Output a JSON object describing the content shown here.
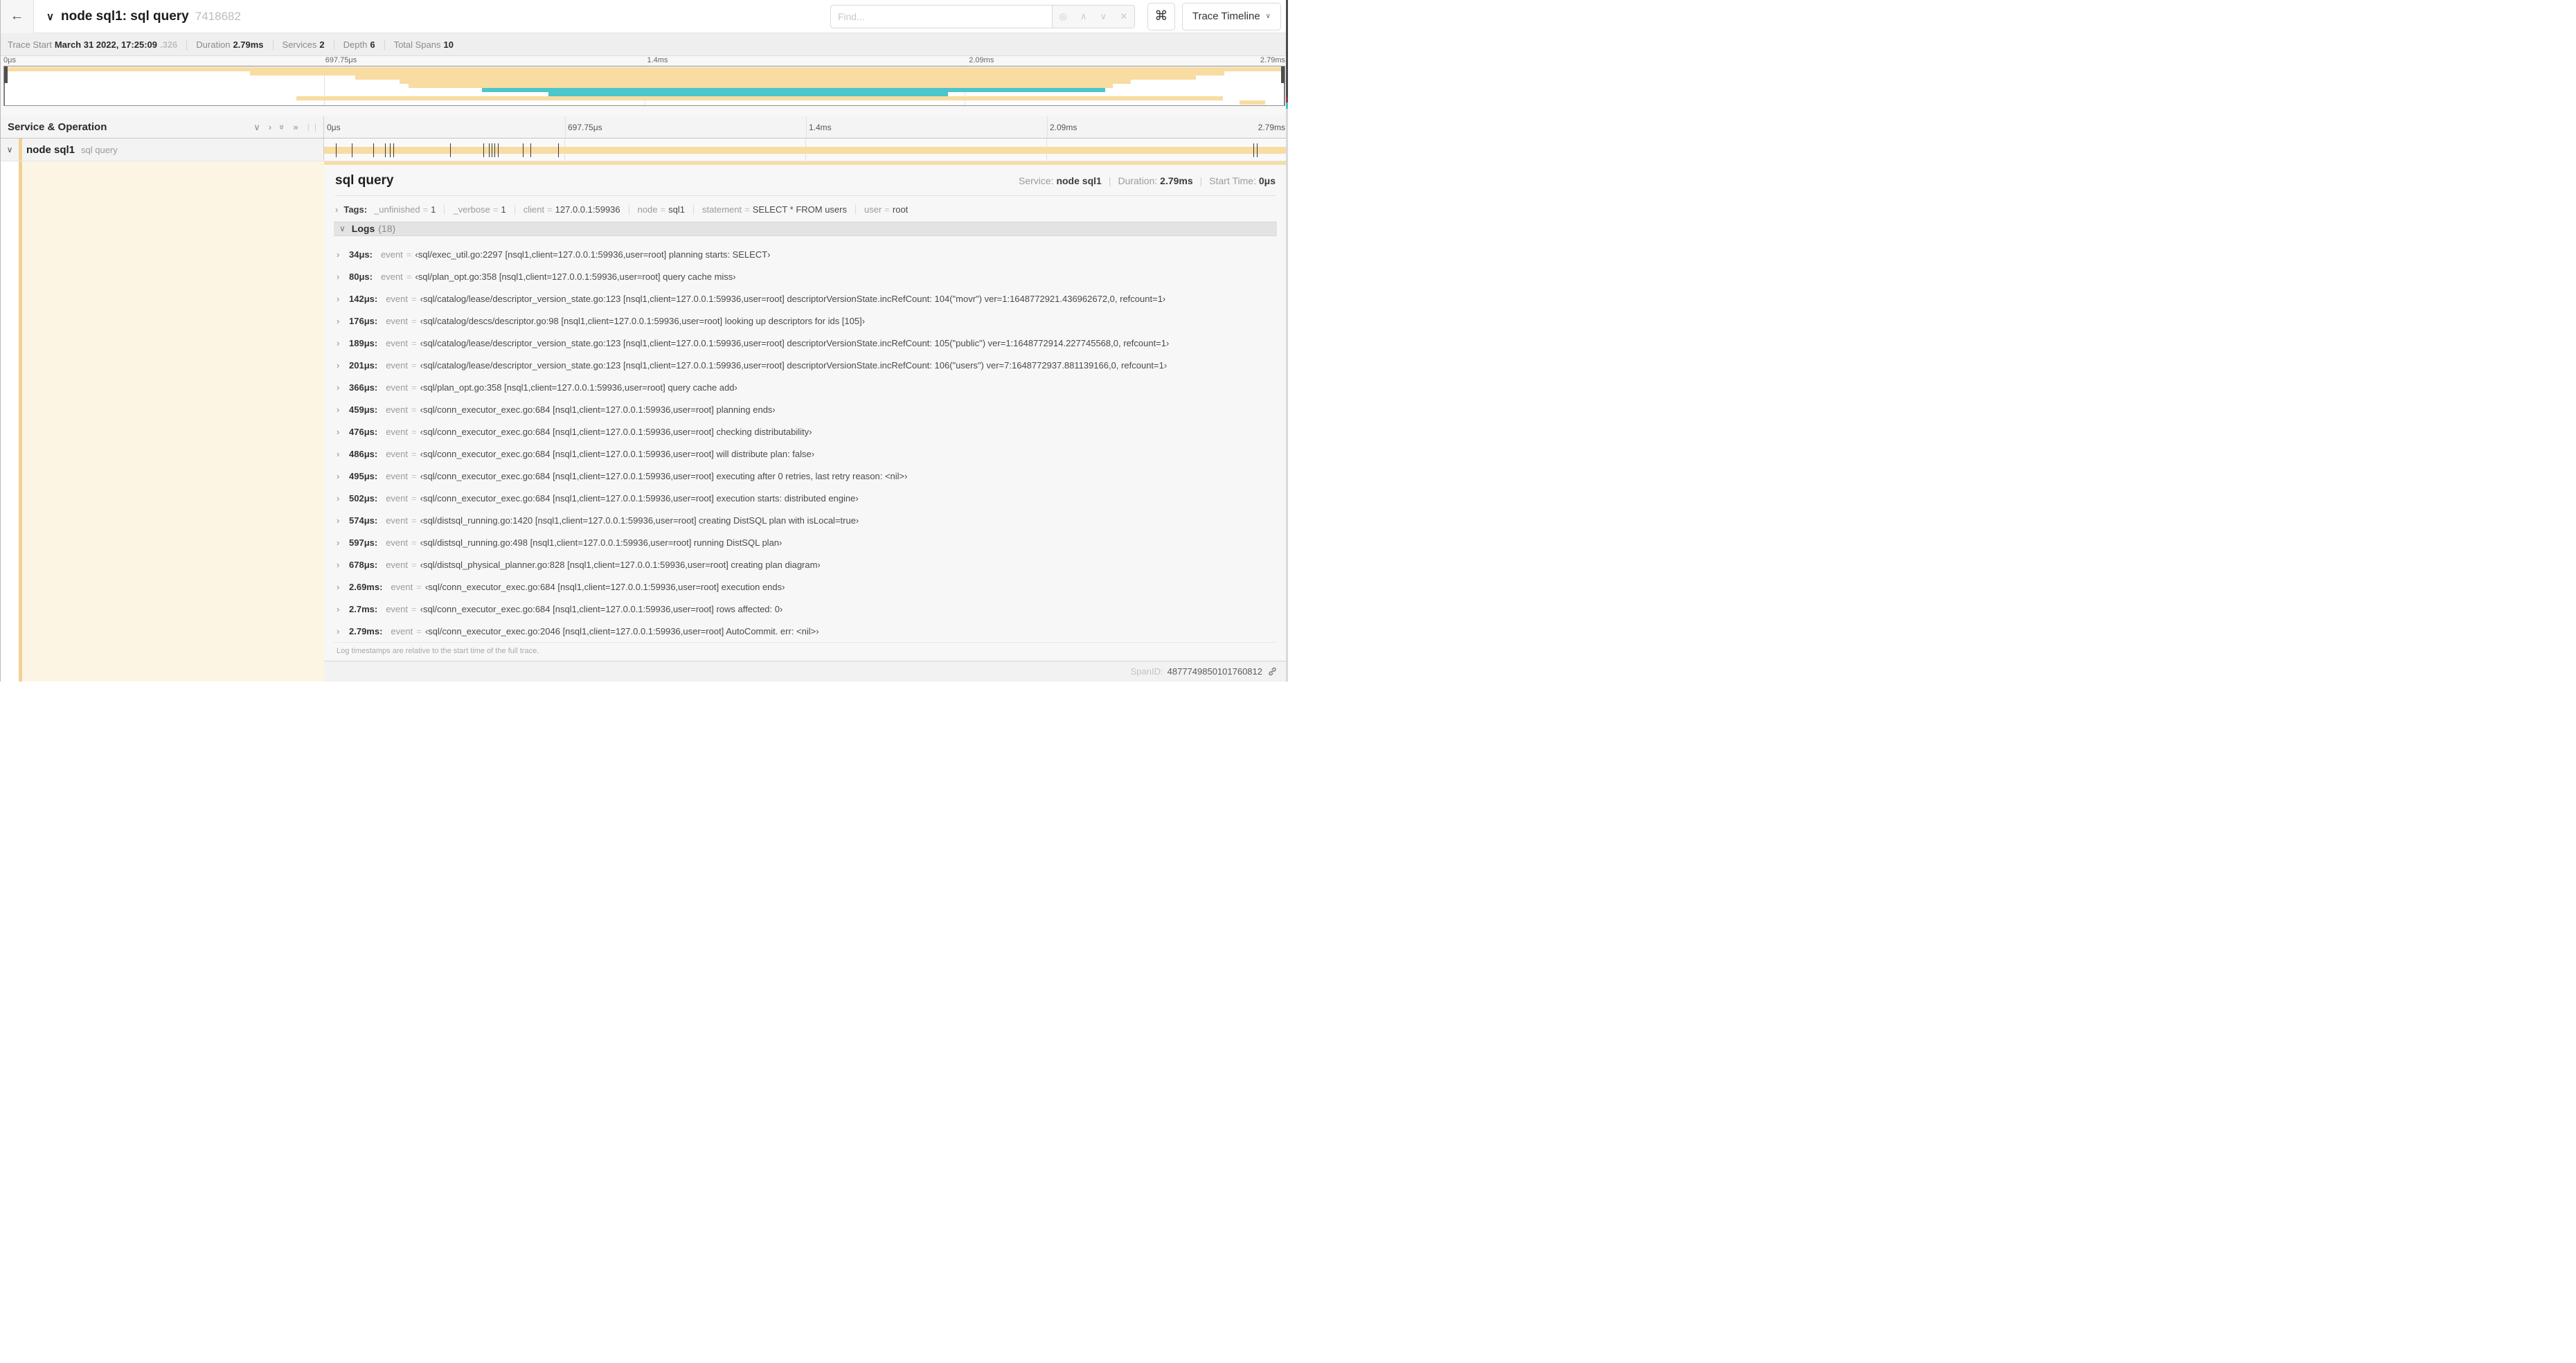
{
  "colors": {
    "tan": "#f8dca2",
    "teal": "#4bc6ca",
    "cream": "#fdf5e4",
    "stripe": "#f1d195"
  },
  "topbar": {
    "back": "←",
    "collapse_chevron": "∨",
    "title": "node sql1: sql query",
    "trace_id": "7418682",
    "find_placeholder": "Find...",
    "shortcut": "⌘",
    "view_select": "Trace Timeline"
  },
  "summary": {
    "items": [
      {
        "label": "Trace Start",
        "value": "March 31 2022, 17:25:09",
        "suffix": ".326"
      },
      {
        "label": "Duration",
        "value": "2.79ms"
      },
      {
        "label": "Services",
        "value": "2"
      },
      {
        "label": "Depth",
        "value": "6"
      },
      {
        "label": "Total Spans",
        "value": "10"
      }
    ]
  },
  "timeline": {
    "ticks": [
      "0μs",
      "697.75μs",
      "1.4ms",
      "2.09ms",
      "2.79ms"
    ],
    "tick_positions": [
      0,
      25,
      50,
      75,
      100
    ],
    "gridlines": [
      25,
      50,
      75
    ],
    "minimap_spans": [
      {
        "color": "tan",
        "start": 0.0,
        "end": 1.0
      },
      {
        "color": "tan",
        "start": 0.192,
        "end": 0.953
      },
      {
        "color": "tan",
        "start": 0.274,
        "end": 0.931
      },
      {
        "color": "tan",
        "start": 0.309,
        "end": 0.88
      },
      {
        "color": "tan",
        "start": 0.316,
        "end": 0.866
      },
      {
        "color": "teal",
        "start": 0.373,
        "end": 0.86
      },
      {
        "color": "teal",
        "start": 0.425,
        "end": 0.737
      },
      {
        "color": "tan",
        "start": 0.228,
        "end": 0.952
      },
      {
        "color": "tan",
        "start": 0.965,
        "end": 0.985
      }
    ],
    "log_marks": [
      0.012,
      0.029,
      0.051,
      0.063,
      0.068,
      0.072,
      0.131,
      0.165,
      0.171,
      0.174,
      0.177,
      0.18,
      0.206,
      0.214,
      0.243,
      0.964,
      0.968,
      0.999
    ]
  },
  "span_list": {
    "header": "Service & Operation",
    "row": {
      "chevron": "∨",
      "service": "node sql1",
      "operation": "sql query"
    }
  },
  "detail": {
    "title": "sql query",
    "service_label": "Service:",
    "service": "node sql1",
    "duration_label": "Duration:",
    "duration": "2.79ms",
    "start_label": "Start Time:",
    "start": "0μs",
    "tags_label": "Tags:",
    "tags": [
      {
        "k": "_unfinished",
        "v": "1"
      },
      {
        "k": "_verbose",
        "v": "1"
      },
      {
        "k": "client",
        "v": "127.0.0.1:59936"
      },
      {
        "k": "node",
        "v": "sql1"
      },
      {
        "k": "statement",
        "v": "SELECT * FROM users"
      },
      {
        "k": "user",
        "v": "root"
      }
    ],
    "logs_label": "Logs",
    "logs_count": "(18)",
    "log_key": "event",
    "logs": [
      {
        "t": "34μs:",
        "v": "sql/exec_util.go:2297 [nsql1,client=127.0.0.1:59936,user=root] planning starts: SELECT"
      },
      {
        "t": "80μs:",
        "v": "sql/plan_opt.go:358 [nsql1,client=127.0.0.1:59936,user=root] query cache miss"
      },
      {
        "t": "142μs:",
        "v": "sql/catalog/lease/descriptor_version_state.go:123 [nsql1,client=127.0.0.1:59936,user=root] descriptorVersionState.incRefCount: 104(\"movr\") ver=1:1648772921.436962672,0, refcount=1"
      },
      {
        "t": "176μs:",
        "v": "sql/catalog/descs/descriptor.go:98 [nsql1,client=127.0.0.1:59936,user=root] looking up descriptors for ids [105]"
      },
      {
        "t": "189μs:",
        "v": "sql/catalog/lease/descriptor_version_state.go:123 [nsql1,client=127.0.0.1:59936,user=root] descriptorVersionState.incRefCount: 105(\"public\") ver=1:1648772914.227745568,0, refcount=1"
      },
      {
        "t": "201μs:",
        "v": "sql/catalog/lease/descriptor_version_state.go:123 [nsql1,client=127.0.0.1:59936,user=root] descriptorVersionState.incRefCount: 106(\"users\") ver=7:1648772937.881139166,0, refcount=1"
      },
      {
        "t": "366μs:",
        "v": "sql/plan_opt.go:358 [nsql1,client=127.0.0.1:59936,user=root] query cache add"
      },
      {
        "t": "459μs:",
        "v": "sql/conn_executor_exec.go:684 [nsql1,client=127.0.0.1:59936,user=root] planning ends"
      },
      {
        "t": "476μs:",
        "v": "sql/conn_executor_exec.go:684 [nsql1,client=127.0.0.1:59936,user=root] checking distributability"
      },
      {
        "t": "486μs:",
        "v": "sql/conn_executor_exec.go:684 [nsql1,client=127.0.0.1:59936,user=root] will distribute plan: false"
      },
      {
        "t": "495μs:",
        "v": "sql/conn_executor_exec.go:684 [nsql1,client=127.0.0.1:59936,user=root] executing after 0 retries, last retry reason: <nil>"
      },
      {
        "t": "502μs:",
        "v": "sql/conn_executor_exec.go:684 [nsql1,client=127.0.0.1:59936,user=root] execution starts: distributed engine"
      },
      {
        "t": "574μs:",
        "v": "sql/distsql_running.go:1420 [nsql1,client=127.0.0.1:59936,user=root] creating DistSQL plan with isLocal=true"
      },
      {
        "t": "597μs:",
        "v": "sql/distsql_running.go:498 [nsql1,client=127.0.0.1:59936,user=root] running DistSQL plan"
      },
      {
        "t": "678μs:",
        "v": "sql/distsql_physical_planner.go:828 [nsql1,client=127.0.0.1:59936,user=root] creating plan diagram"
      },
      {
        "t": "2.69ms:",
        "v": "sql/conn_executor_exec.go:684 [nsql1,client=127.0.0.1:59936,user=root] execution ends"
      },
      {
        "t": "2.7ms:",
        "v": "sql/conn_executor_exec.go:684 [nsql1,client=127.0.0.1:59936,user=root] rows affected: 0"
      },
      {
        "t": "2.79ms:",
        "v": "sql/conn_executor_exec.go:2046 [nsql1,client=127.0.0.1:59936,user=root] AutoCommit. err: <nil>"
      }
    ],
    "footer_note": "Log timestamps are relative to the start time of the full trace.",
    "spanid_label": "SpanID:",
    "spanid": "4877749850101760812"
  }
}
